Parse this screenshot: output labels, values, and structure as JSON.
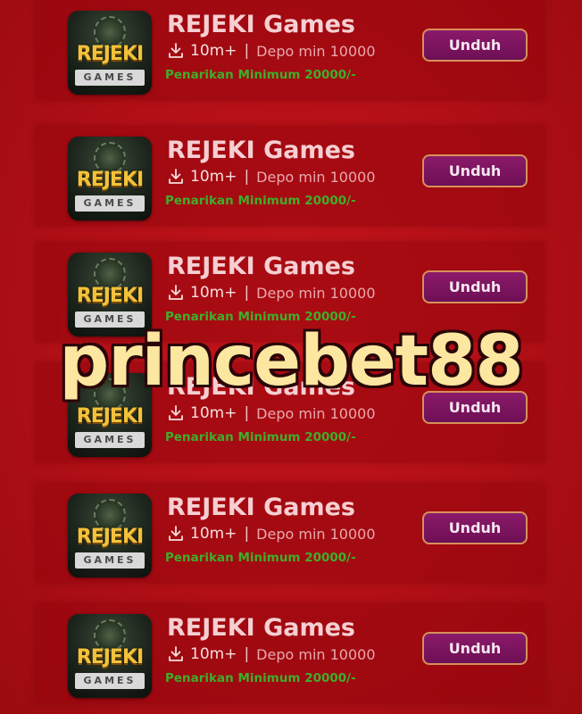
{
  "apps": [
    {
      "title": "REJEKI Games",
      "downloads": "10m+",
      "separator": "|",
      "depo": "Depo min 10000",
      "withdraw": "Penarikan Minimum 20000/-",
      "button": "Unduh",
      "logo_word": "REJEKI",
      "logo_sub": "GAMES"
    },
    {
      "title": "REJEKI Games",
      "downloads": "10m+",
      "separator": "|",
      "depo": "Depo min 10000",
      "withdraw": "Penarikan Minimum 20000/-",
      "button": "Unduh",
      "logo_word": "REJEKI",
      "logo_sub": "GAMES"
    },
    {
      "title": "REJEKI Games",
      "downloads": "10m+",
      "separator": "|",
      "depo": "Depo min 10000",
      "withdraw": "Penarikan Minimum 20000/-",
      "button": "Unduh",
      "logo_word": "REJEKI",
      "logo_sub": "GAMES"
    },
    {
      "title": "REJEKI Games",
      "downloads": "10m+",
      "separator": "|",
      "depo": "Depo min 10000",
      "withdraw": "Penarikan Minimum 20000/-",
      "button": "Unduh",
      "logo_word": "REJEKI",
      "logo_sub": "GAMES"
    },
    {
      "title": "REJEKI Games",
      "downloads": "10m+",
      "separator": "|",
      "depo": "Depo min 10000",
      "withdraw": "Penarikan Minimum 20000/-",
      "button": "Unduh",
      "logo_word": "REJEKI",
      "logo_sub": "GAMES"
    },
    {
      "title": "REJEKI Games",
      "downloads": "10m+",
      "separator": "|",
      "depo": "Depo min 10000",
      "withdraw": "Penarikan Minimum 20000/-",
      "button": "Unduh",
      "logo_word": "REJEKI",
      "logo_sub": "GAMES"
    }
  ],
  "overlay_text": "princebet88",
  "colors": {
    "background": "#b10f16",
    "button": "#7a1460",
    "button_border": "#d6915a",
    "withdraw_text": "#3fae2b",
    "overlay_fill": "#fbe7a0"
  },
  "icons": {
    "download": "download-icon",
    "logo": "app-logo-icon"
  }
}
